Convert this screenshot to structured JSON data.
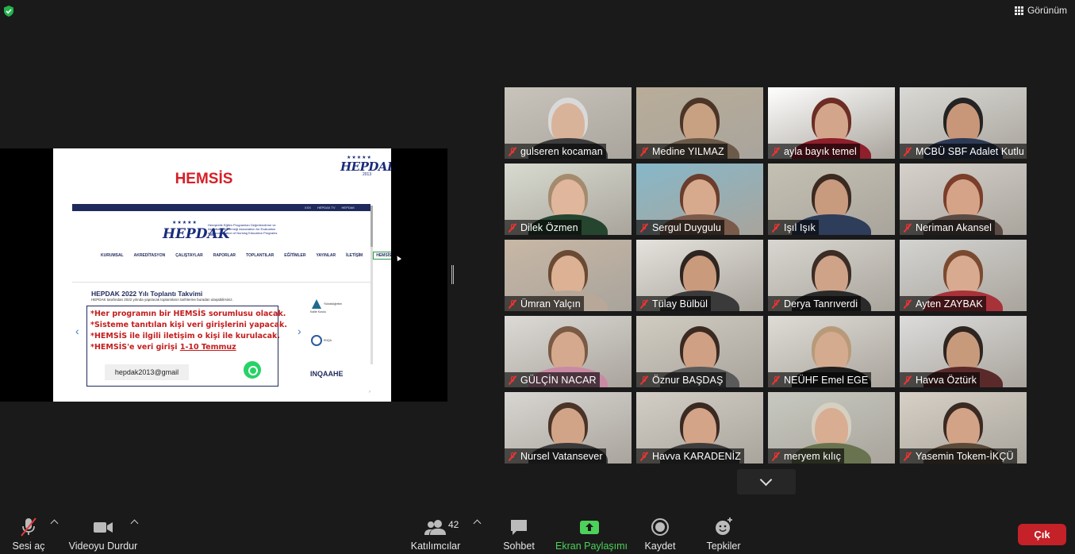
{
  "top": {
    "view_label": "Görünüm",
    "shield_color": "#23b34d"
  },
  "slide": {
    "title": "HEMSİS",
    "logo_text": "HEPDAK",
    "logo_year": "2013",
    "web_top_links": [
      "XXX",
      "HEPDAK TV",
      "HEPDAK"
    ],
    "web_logo_desc": "Hemşirelik Eğitim Programları Değerlendirme ve Akreditasyon Derneği Association for Evaluation and Accreditation of Nursing Education Programs",
    "nav": [
      "KURUMSAL",
      "AKREDİTASYON",
      "ÇALIŞTAYLAR",
      "RAPORLAR",
      "TOPLANTILAR",
      "EĞİTİMLER",
      "YAYINLAR",
      "İLETİŞİM",
      "HEMSİS"
    ],
    "meeting_title": "HEPDAK 2022 Yılı Toplantı Takvimi",
    "meeting_sub": "HEPDAK tarafından 2022 yılında yapılacak toplantıların tarihlerine buradan ulaşabilirsiniz.",
    "notice_lines": [
      "*Her programın bir HEMSİS sorumlusu olacak.",
      "*Sisteme tanıtılan kişi veri  girişlerini yapacak.",
      "*HEMSİS ile ilgili iletişim o kişi ile kurulacak.",
      "*HEMSİS'e veri girişi "
    ],
    "notice_date": "1-10 Temmuz",
    "email": "hepdak2013@gmail",
    "side_logos": [
      "Yükseköğretim Kalite Kurulu",
      "ENQA",
      "INQAAHE"
    ],
    "page_mark": "›"
  },
  "participants": [
    {
      "name": "gulseren kocaman",
      "bg": "#c9c4bb",
      "skin": "#d8b39a",
      "hair": "#d9d9d9",
      "shirt": "#3c3c3c"
    },
    {
      "name": "Medine YILMAZ",
      "bg": "#b9ad99",
      "skin": "#c8a182",
      "hair": "#4a3527",
      "shirt": "#6b5a4a"
    },
    {
      "name": "ayla bayık temel",
      "bg": "#ffffff",
      "skin": "#d3a68c",
      "hair": "#6b2d24",
      "shirt": "#8e1f2b"
    },
    {
      "name": "MCBÜ SBF Adalet Kutlu",
      "bg": "#d9d9d5",
      "skin": "#c89779",
      "hair": "#232323",
      "shirt": "#2d3a55"
    },
    {
      "name": "Dilek Özmen",
      "bg": "#d8dbd0",
      "skin": "#e0b79d",
      "hair": "#a58b6e",
      "shirt": "#25452f"
    },
    {
      "name": "Sergul Duygulu",
      "bg": "#86b8c9",
      "skin": "#d8aa8d",
      "hair": "#6a3d2c",
      "shirt": "#7a5a4a"
    },
    {
      "name": "Işıl Işık",
      "bg": "#c4c1b3",
      "skin": "#c89a7e",
      "hair": "#3a2a22",
      "shirt": "#2d3d5a"
    },
    {
      "name": "Neriman Akansel",
      "bg": "#d6d1cb",
      "skin": "#d5a488",
      "hair": "#7a3e2a",
      "shirt": "#5a4a44"
    },
    {
      "name": "Ümran Yalçın",
      "bg": "#c8b7a5",
      "skin": "#dcb194",
      "hair": "#6a4a33",
      "shirt": "#b8a89a"
    },
    {
      "name": "Tülay Bülbül",
      "bg": "#e4e2dc",
      "skin": "#c99a7c",
      "hair": "#2e2520",
      "shirt": "#3a3a3a"
    },
    {
      "name": "Derya Tanrıverdi",
      "bg": "#d8d6d0",
      "skin": "#cfa387",
      "hair": "#3b2d26",
      "shirt": "#2a2a2a"
    },
    {
      "name": "Ayten ZAYBAK",
      "bg": "#d3d3d1",
      "skin": "#d8ab90",
      "hair": "#7a4a30",
      "shirt": "#a8323a"
    },
    {
      "name": "GÜLÇİN NACAR",
      "bg": "#dcdad6",
      "skin": "#d5a98e",
      "hair": "#7a5a44",
      "shirt": "#c98aa4"
    },
    {
      "name": "Öznur BAŞDAŞ",
      "bg": "#d1ccc2",
      "skin": "#cfa084",
      "hair": "#3a2a22",
      "shirt": "#5a5a5a"
    },
    {
      "name": "NEÜHF Emel EGE",
      "bg": "#dedcd6",
      "skin": "#d5ab90",
      "hair": "#b89a7a",
      "shirt": "#1f1f1f"
    },
    {
      "name": "Havva Öztürk",
      "bg": "#dcdcdc",
      "skin": "#c89a7c",
      "hair": "#2e2420",
      "shirt": "#5a2a2a"
    },
    {
      "name": "Nursel Vatansever",
      "bg": "#d8d6d2",
      "skin": "#d1a488",
      "hair": "#4a3427",
      "shirt": "#3a3a3a"
    },
    {
      "name": "Havva KARADENİZ",
      "bg": "#d2cec6",
      "skin": "#d3a487",
      "hair": "#3b2a22",
      "shirt": "#3d3d3d"
    },
    {
      "name": "meryem kılıç",
      "bg": "#c7c9c0",
      "skin": "#d8ad92",
      "hair": "#d6d0c2",
      "shirt": "#6a7350"
    },
    {
      "name": "Yasemin Tokem-İKÇÜ",
      "bg": "#d6d0c6",
      "skin": "#d3a388",
      "hair": "#3b2a22",
      "shirt": "#5a4a3a"
    }
  ],
  "toolbar": {
    "mute_label": "Sesi aç",
    "video_label": "Videoyu Durdur",
    "participants_label": "Katılımcılar",
    "participants_count": "42",
    "chat_label": "Sohbet",
    "share_label": "Ekran Paylaşımı",
    "record_label": "Kaydet",
    "reactions_label": "Tepkiler",
    "leave_label": "Çık",
    "share_color": "#4dd15a",
    "leave_color": "#c52128"
  }
}
